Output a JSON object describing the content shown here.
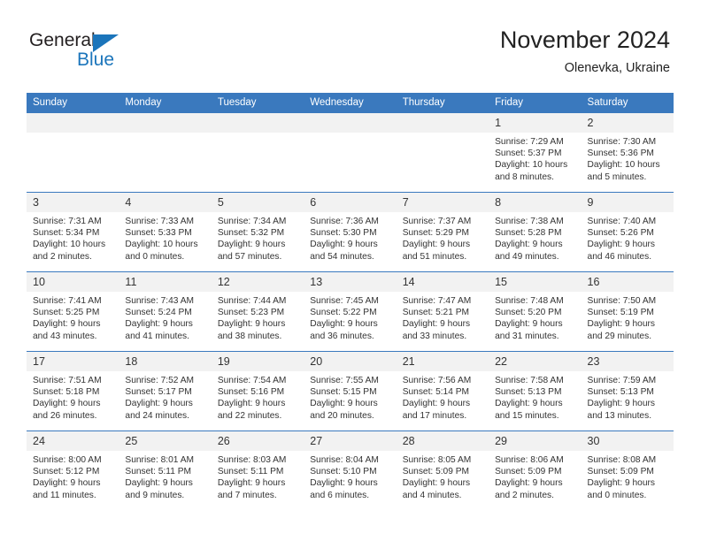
{
  "logo": {
    "word1": "General",
    "word2": "Blue",
    "accent_color": "#1b75bb",
    "icon": "triangle-flag"
  },
  "header": {
    "title": "November 2024",
    "subtitle": "Olenevka, Ukraine"
  },
  "theme": {
    "header_bg": "#3a79be",
    "daynum_bg": "#f2f2f2",
    "text": "#333333"
  },
  "weekday_headers": [
    "Sunday",
    "Monday",
    "Tuesday",
    "Wednesday",
    "Thursday",
    "Friday",
    "Saturday"
  ],
  "weeks": [
    [
      {
        "day": "",
        "lines": []
      },
      {
        "day": "",
        "lines": []
      },
      {
        "day": "",
        "lines": []
      },
      {
        "day": "",
        "lines": []
      },
      {
        "day": "",
        "lines": []
      },
      {
        "day": "1",
        "lines": [
          "Sunrise: 7:29 AM",
          "Sunset: 5:37 PM",
          "Daylight: 10 hours",
          "and 8 minutes."
        ]
      },
      {
        "day": "2",
        "lines": [
          "Sunrise: 7:30 AM",
          "Sunset: 5:36 PM",
          "Daylight: 10 hours",
          "and 5 minutes."
        ]
      }
    ],
    [
      {
        "day": "3",
        "lines": [
          "Sunrise: 7:31 AM",
          "Sunset: 5:34 PM",
          "Daylight: 10 hours",
          "and 2 minutes."
        ]
      },
      {
        "day": "4",
        "lines": [
          "Sunrise: 7:33 AM",
          "Sunset: 5:33 PM",
          "Daylight: 10 hours",
          "and 0 minutes."
        ]
      },
      {
        "day": "5",
        "lines": [
          "Sunrise: 7:34 AM",
          "Sunset: 5:32 PM",
          "Daylight: 9 hours",
          "and 57 minutes."
        ]
      },
      {
        "day": "6",
        "lines": [
          "Sunrise: 7:36 AM",
          "Sunset: 5:30 PM",
          "Daylight: 9 hours",
          "and 54 minutes."
        ]
      },
      {
        "day": "7",
        "lines": [
          "Sunrise: 7:37 AM",
          "Sunset: 5:29 PM",
          "Daylight: 9 hours",
          "and 51 minutes."
        ]
      },
      {
        "day": "8",
        "lines": [
          "Sunrise: 7:38 AM",
          "Sunset: 5:28 PM",
          "Daylight: 9 hours",
          "and 49 minutes."
        ]
      },
      {
        "day": "9",
        "lines": [
          "Sunrise: 7:40 AM",
          "Sunset: 5:26 PM",
          "Daylight: 9 hours",
          "and 46 minutes."
        ]
      }
    ],
    [
      {
        "day": "10",
        "lines": [
          "Sunrise: 7:41 AM",
          "Sunset: 5:25 PM",
          "Daylight: 9 hours",
          "and 43 minutes."
        ]
      },
      {
        "day": "11",
        "lines": [
          "Sunrise: 7:43 AM",
          "Sunset: 5:24 PM",
          "Daylight: 9 hours",
          "and 41 minutes."
        ]
      },
      {
        "day": "12",
        "lines": [
          "Sunrise: 7:44 AM",
          "Sunset: 5:23 PM",
          "Daylight: 9 hours",
          "and 38 minutes."
        ]
      },
      {
        "day": "13",
        "lines": [
          "Sunrise: 7:45 AM",
          "Sunset: 5:22 PM",
          "Daylight: 9 hours",
          "and 36 minutes."
        ]
      },
      {
        "day": "14",
        "lines": [
          "Sunrise: 7:47 AM",
          "Sunset: 5:21 PM",
          "Daylight: 9 hours",
          "and 33 minutes."
        ]
      },
      {
        "day": "15",
        "lines": [
          "Sunrise: 7:48 AM",
          "Sunset: 5:20 PM",
          "Daylight: 9 hours",
          "and 31 minutes."
        ]
      },
      {
        "day": "16",
        "lines": [
          "Sunrise: 7:50 AM",
          "Sunset: 5:19 PM",
          "Daylight: 9 hours",
          "and 29 minutes."
        ]
      }
    ],
    [
      {
        "day": "17",
        "lines": [
          "Sunrise: 7:51 AM",
          "Sunset: 5:18 PM",
          "Daylight: 9 hours",
          "and 26 minutes."
        ]
      },
      {
        "day": "18",
        "lines": [
          "Sunrise: 7:52 AM",
          "Sunset: 5:17 PM",
          "Daylight: 9 hours",
          "and 24 minutes."
        ]
      },
      {
        "day": "19",
        "lines": [
          "Sunrise: 7:54 AM",
          "Sunset: 5:16 PM",
          "Daylight: 9 hours",
          "and 22 minutes."
        ]
      },
      {
        "day": "20",
        "lines": [
          "Sunrise: 7:55 AM",
          "Sunset: 5:15 PM",
          "Daylight: 9 hours",
          "and 20 minutes."
        ]
      },
      {
        "day": "21",
        "lines": [
          "Sunrise: 7:56 AM",
          "Sunset: 5:14 PM",
          "Daylight: 9 hours",
          "and 17 minutes."
        ]
      },
      {
        "day": "22",
        "lines": [
          "Sunrise: 7:58 AM",
          "Sunset: 5:13 PM",
          "Daylight: 9 hours",
          "and 15 minutes."
        ]
      },
      {
        "day": "23",
        "lines": [
          "Sunrise: 7:59 AM",
          "Sunset: 5:13 PM",
          "Daylight: 9 hours",
          "and 13 minutes."
        ]
      }
    ],
    [
      {
        "day": "24",
        "lines": [
          "Sunrise: 8:00 AM",
          "Sunset: 5:12 PM",
          "Daylight: 9 hours",
          "and 11 minutes."
        ]
      },
      {
        "day": "25",
        "lines": [
          "Sunrise: 8:01 AM",
          "Sunset: 5:11 PM",
          "Daylight: 9 hours",
          "and 9 minutes."
        ]
      },
      {
        "day": "26",
        "lines": [
          "Sunrise: 8:03 AM",
          "Sunset: 5:11 PM",
          "Daylight: 9 hours",
          "and 7 minutes."
        ]
      },
      {
        "day": "27",
        "lines": [
          "Sunrise: 8:04 AM",
          "Sunset: 5:10 PM",
          "Daylight: 9 hours",
          "and 6 minutes."
        ]
      },
      {
        "day": "28",
        "lines": [
          "Sunrise: 8:05 AM",
          "Sunset: 5:09 PM",
          "Daylight: 9 hours",
          "and 4 minutes."
        ]
      },
      {
        "day": "29",
        "lines": [
          "Sunrise: 8:06 AM",
          "Sunset: 5:09 PM",
          "Daylight: 9 hours",
          "and 2 minutes."
        ]
      },
      {
        "day": "30",
        "lines": [
          "Sunrise: 8:08 AM",
          "Sunset: 5:09 PM",
          "Daylight: 9 hours",
          "and 0 minutes."
        ]
      }
    ]
  ]
}
